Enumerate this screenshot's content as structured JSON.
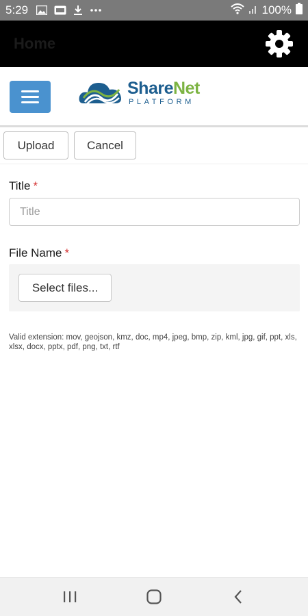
{
  "status_bar": {
    "time": "5:29",
    "battery": "100%",
    "icons": [
      "image-icon",
      "sim-icon",
      "download-icon",
      "more-dots-icon",
      "wifi-icon",
      "signal-icon",
      "battery-icon"
    ]
  },
  "app_header": {
    "title": "Home",
    "settings_icon": "gear-icon"
  },
  "logo": {
    "brand_part1": "Share",
    "brand_part2": "Net",
    "subtitle": "PLATFORM",
    "colors": {
      "primary": "#1d5e8f",
      "accent": "#7cb342"
    }
  },
  "menu_button": {
    "icon": "hamburger-menu-icon",
    "color": "#4a92cf"
  },
  "toolbar": {
    "upload_label": "Upload",
    "cancel_label": "Cancel"
  },
  "form": {
    "title_label": "Title",
    "title_required": "*",
    "title_placeholder": "Title",
    "file_label": "File Name",
    "file_required": "*",
    "select_files_label": "Select files...",
    "valid_extensions": "Valid extension: mov, geojson, kmz, doc, mp4, jpeg, bmp, zip, kml, jpg, gif, ppt, xls, xlsx, docx, pptx, pdf, png, txt, rtf"
  },
  "nav_bar": {
    "icons": [
      "recent-apps-icon",
      "home-icon",
      "back-icon"
    ]
  }
}
